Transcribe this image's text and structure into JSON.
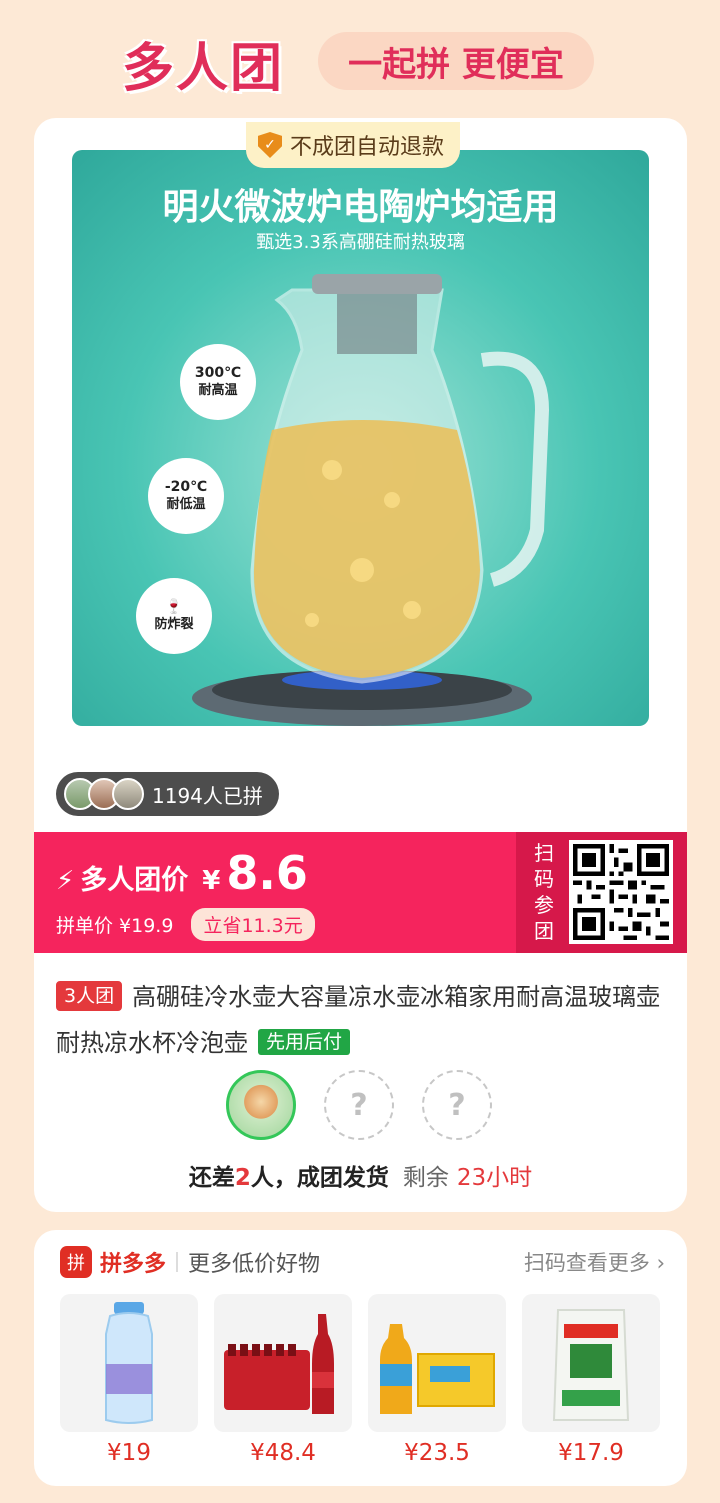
{
  "header": {
    "brand": "多人团",
    "slogan": "一起拼 更便宜"
  },
  "badge": {
    "refund_text": "不成团自动退款",
    "shield_icon": "shield-check-icon"
  },
  "product_image": {
    "title": "明火微波炉电陶炉均适用",
    "subtitle": "甄选3.3系高硼硅耐热玻璃",
    "features": [
      {
        "symbol": "300℃",
        "label": "耐高温"
      },
      {
        "symbol": "-20℃",
        "label": "耐低温"
      },
      {
        "symbol": "",
        "label": "防炸裂"
      }
    ]
  },
  "joined": {
    "text": "1194人已拼"
  },
  "price": {
    "group_label": "多人团价",
    "currency": "¥",
    "group_price": "8.6",
    "single_label": "拼单价 ¥19.9",
    "save_text": "立省11.3元",
    "scan_text": "扫码参团"
  },
  "product": {
    "group_tag": "3人团",
    "title": "高硼硅冷水壶大容量凉水壶冰箱家用耐高温玻璃壶耐热凉水杯冷泡壶",
    "pay_tag": "先用后付"
  },
  "status": {
    "prefix": "还差",
    "missing": "2",
    "suffix": "人，成团发货",
    "remain_label": "剩余",
    "remain_time": "23小时",
    "empty_slot": "?"
  },
  "more": {
    "logo_char": "拼",
    "brand": "拼多多",
    "subtitle": "更多低价好物",
    "scan_more": "扫码查看更多 ›",
    "items": [
      {
        "price": "¥19"
      },
      {
        "price": "¥48.4"
      },
      {
        "price": "¥23.5"
      },
      {
        "price": "¥17.9"
      }
    ]
  },
  "colors": {
    "brand_pink": "#e02e5a",
    "price_red": "#f5245d",
    "accent_green": "#21a645",
    "page_bg": "#fde9d6"
  }
}
